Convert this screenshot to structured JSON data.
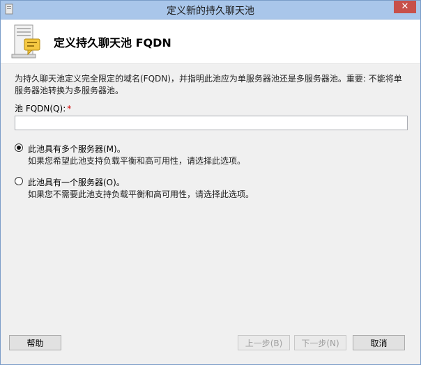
{
  "window": {
    "title": "定义新的持久聊天池",
    "close_glyph": "✕"
  },
  "header": {
    "title": "定义持久聊天池 FQDN",
    "icon": "server-chat-icon"
  },
  "description": "为持久聊天池定义完全限定的域名(FQDN)，并指明此池应为单服务器池还是多服务器池。重要: 不能将单服务器池转换为多服务器池。",
  "pool_fqdn": {
    "label": "池 FQDN(Q):",
    "required_mark": "*",
    "value": ""
  },
  "options": [
    {
      "label": "此池具有多个服务器(M)。",
      "description": "如果您希望此池支持负载平衡和高可用性，请选择此选项。",
      "selected": true
    },
    {
      "label": "此池具有一个服务器(O)。",
      "description": "如果您不需要此池支持负载平衡和高可用性，请选择此选项。",
      "selected": false
    }
  ],
  "buttons": {
    "help": "帮助",
    "back": "上一步(B)",
    "next": "下一步(N)",
    "cancel": "取消"
  },
  "colors": {
    "titlebar": "#a9c6ea",
    "required": "#d00000",
    "close": "#c7504a"
  }
}
